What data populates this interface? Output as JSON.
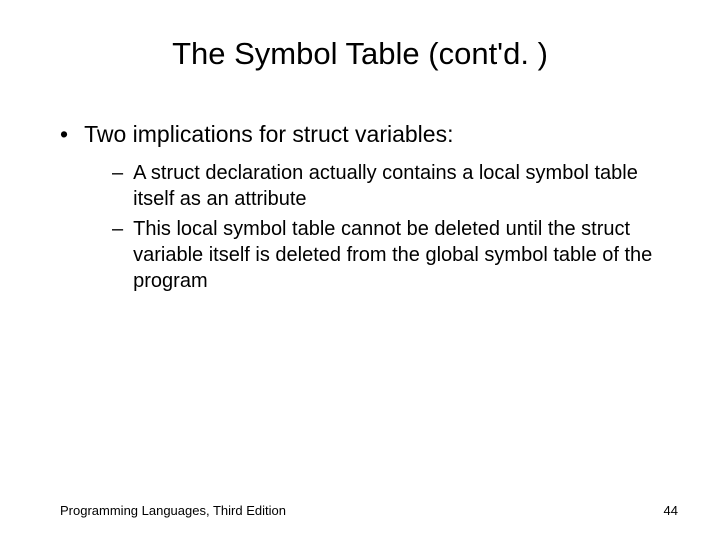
{
  "title": "The Symbol Table (cont'd. )",
  "main_bullet": "Two implications for struct variables:",
  "sub_bullets": [
    "A struct declaration actually contains a local symbol table itself as an attribute",
    "This local symbol table cannot be deleted until the struct variable itself is deleted from the global symbol table of the program"
  ],
  "footer_left": "Programming Languages, Third Edition",
  "footer_right": "44"
}
